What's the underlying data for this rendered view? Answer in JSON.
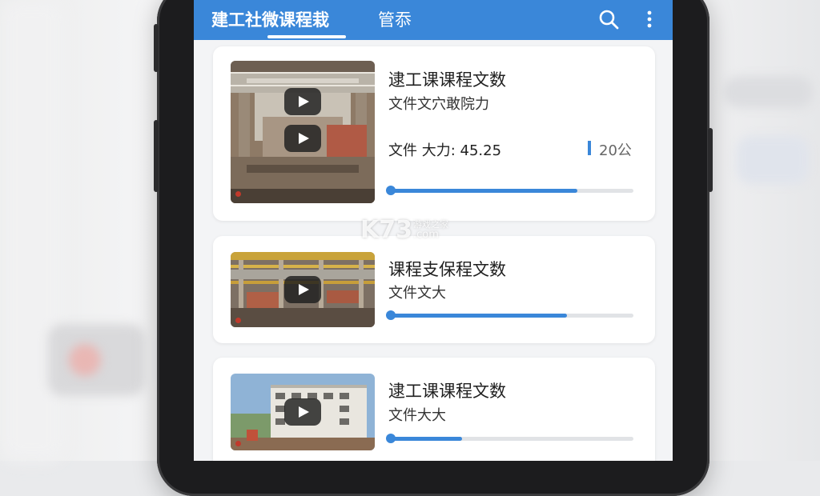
{
  "app_bar": {
    "tabs": [
      {
        "label": "建工社微课程栽",
        "active": true
      },
      {
        "label": "管忝",
        "active": false
      }
    ],
    "accent_color": "#3a87d9"
  },
  "icons": {
    "search": "search-icon",
    "more": "more-vert-icon",
    "play": "play-icon"
  },
  "courses": [
    {
      "title": "逮工课课程文数",
      "subtitle": "文件文穴敢院力",
      "meta": "文件 大力: 45.25",
      "count": "20公",
      "progress": 0.77
    },
    {
      "title": "课程支保程文数",
      "subtitle": "文件文大",
      "progress": 0.73
    },
    {
      "title": "逮工课课程文数",
      "subtitle": "文件大大",
      "progress": 0.3
    }
  ],
  "watermark": {
    "logo": "K73",
    "tagline": "游戏之家",
    "domain": ".com"
  }
}
